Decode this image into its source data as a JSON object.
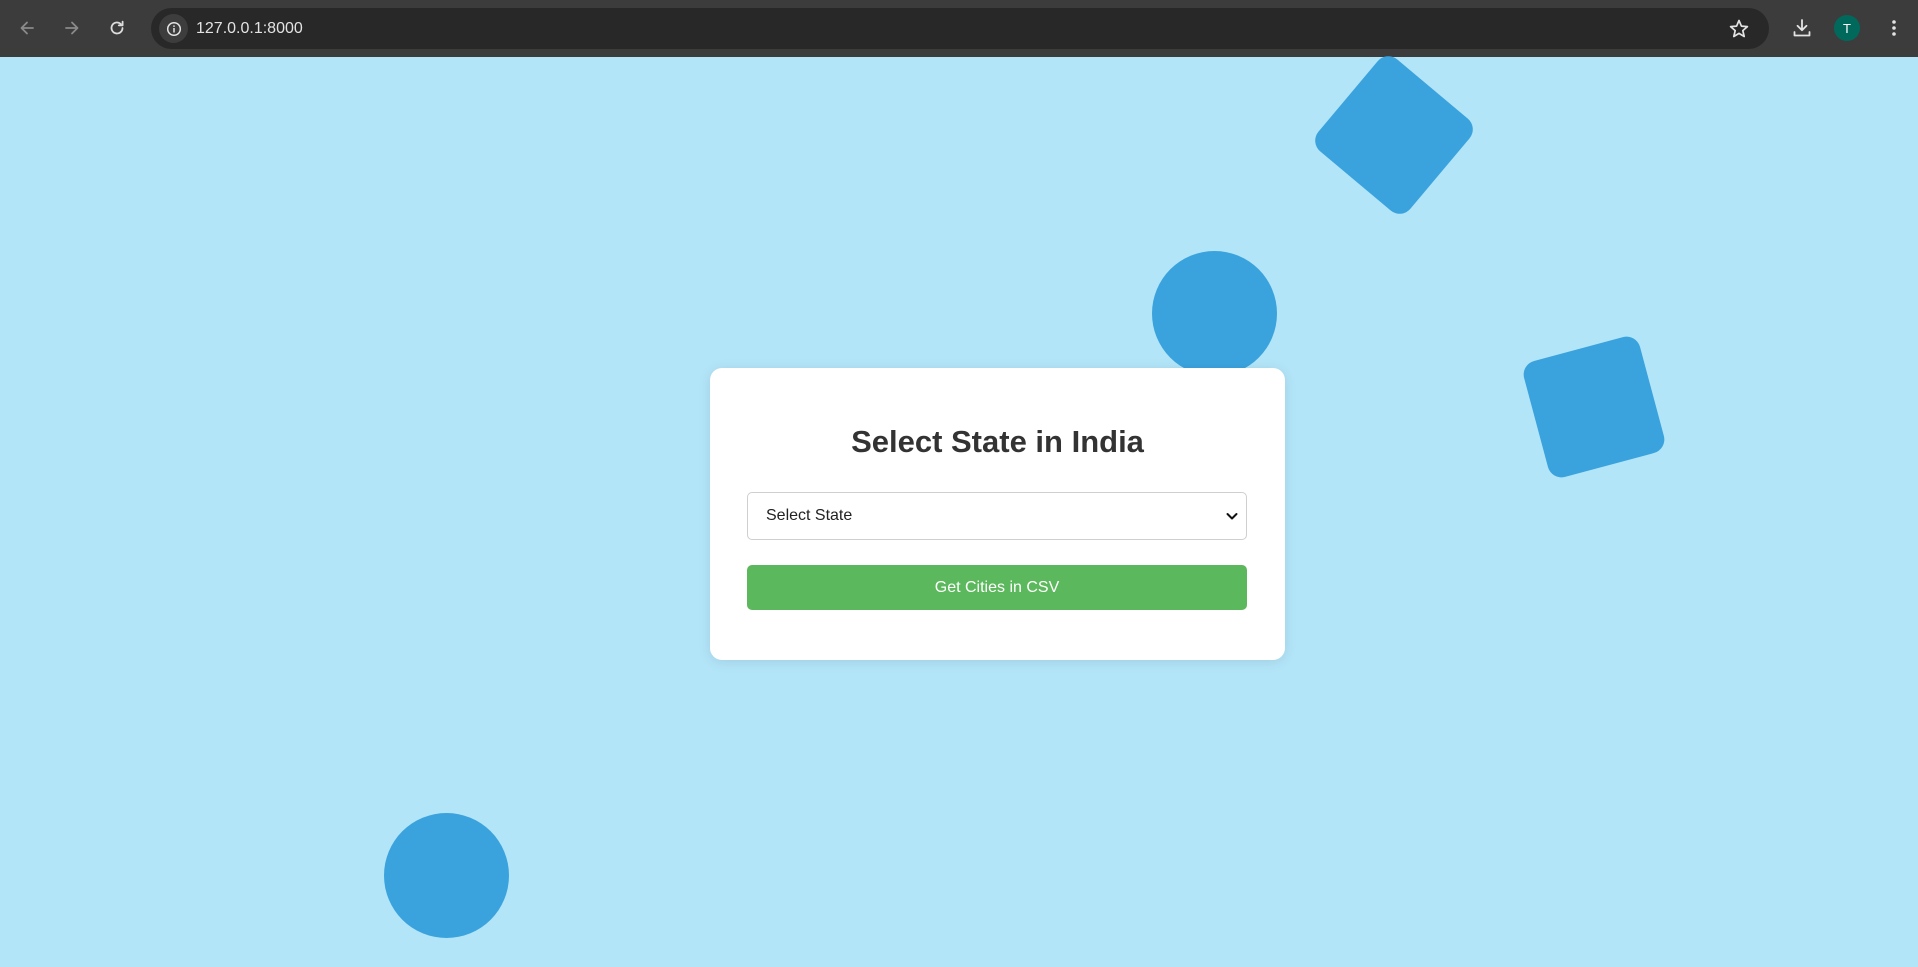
{
  "browser": {
    "url": "127.0.0.1:8000",
    "profile_initial": "T",
    "icons": {
      "back": "back-arrow-icon",
      "forward": "forward-arrow-icon",
      "reload": "reload-icon",
      "site_info": "info-icon",
      "bookmark": "star-icon",
      "downloads": "download-icon",
      "menu": "kebab-menu-icon"
    }
  },
  "page": {
    "title": "Select State in India",
    "select": {
      "selected": "Select State"
    },
    "button_label": "Get Cities in CSV"
  },
  "colors": {
    "background": "#b3e5f9",
    "shape": "#3aa3de",
    "button": "#5cb85c",
    "title": "#333333"
  }
}
